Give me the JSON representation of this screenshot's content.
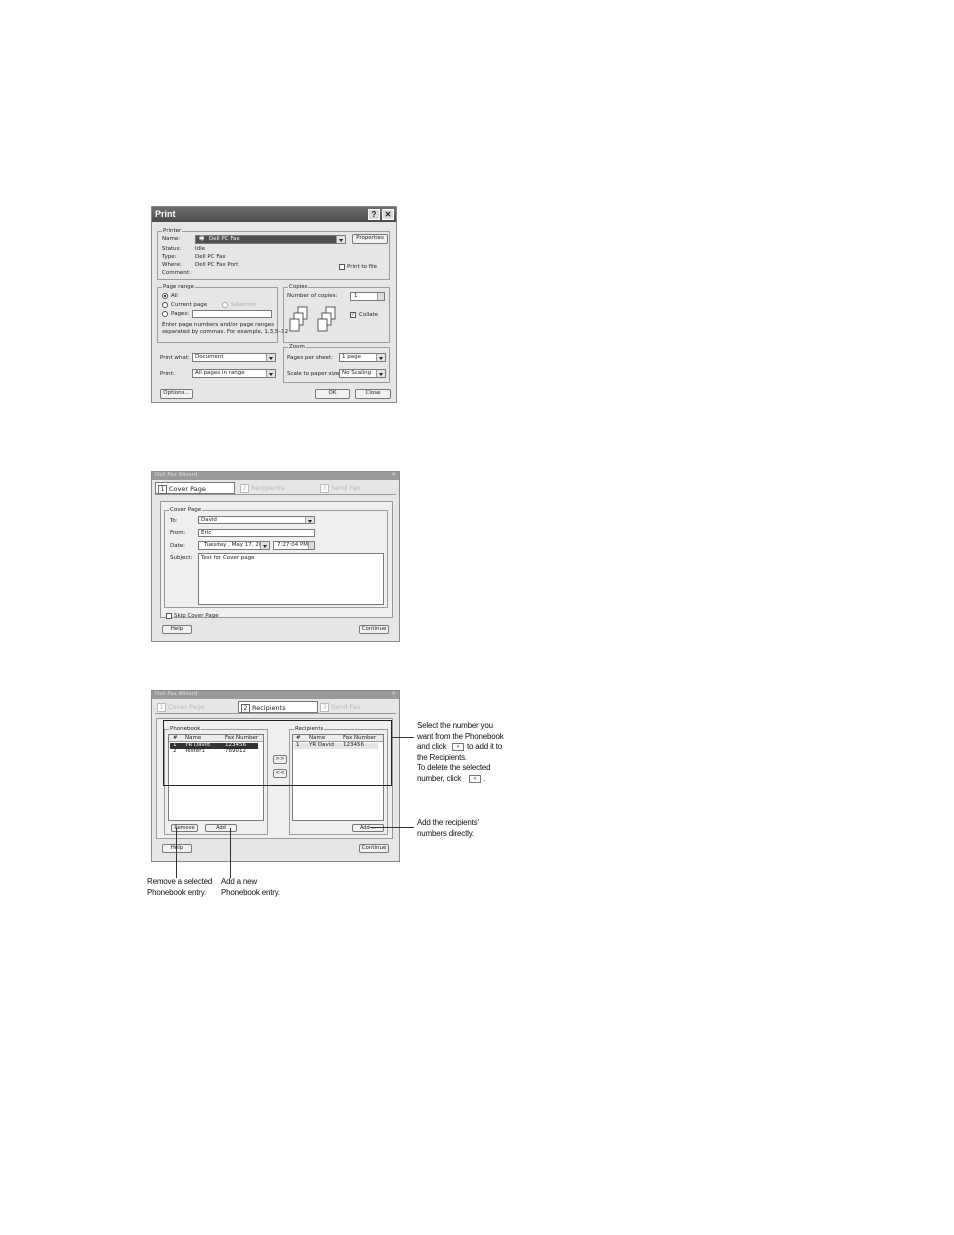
{
  "print_dialog": {
    "title": "Print",
    "help_btn": "?",
    "close_btn": "✕",
    "printer_group": "Printer",
    "name_label": "Name:",
    "name_value": "Dell PC Fax",
    "properties_btn": "Properties",
    "status_label": "Status:",
    "status_value": "Idle",
    "type_label": "Type:",
    "type_value": "Dell PC Fax",
    "where_label": "Where:",
    "where_value": "Dell PC Fax Port",
    "comment_label": "Comment:",
    "print_to_file": "Print to file",
    "page_range_group": "Page range",
    "all": "All",
    "current_page": "Current page",
    "selection": "Selection",
    "pages": "Pages:",
    "hint1": "Enter page numbers and/or page ranges",
    "hint2": "separated by commas.  For example, 1,3,5–12",
    "copies_group": "Copies",
    "num_copies": "Number of copies:",
    "copies_value": "1",
    "collate": "Collate",
    "print_what_label": "Print what:",
    "print_what_value": "Document",
    "print_label": "Print:",
    "print_value": "All pages in range",
    "zoom_group": "Zoom",
    "pps_label": "Pages per sheet:",
    "pps_value": "1 page",
    "scale_label": "Scale to paper size:",
    "scale_value": "No Scaling",
    "options_btn": "Options...",
    "ok_btn": "OK",
    "cancel_btn": "Close"
  },
  "cover_dialog": {
    "title": "Dell Fax Wizard",
    "tabs": [
      {
        "num": "1",
        "label": "Cover Page"
      },
      {
        "num": "2",
        "label": "Recipients"
      },
      {
        "num": "3",
        "label": "Send Fax"
      }
    ],
    "group": "Cover Page",
    "to_label": "To:",
    "to_value": "David",
    "from_label": "From:",
    "from_value": "Eric",
    "date_label": "Date:",
    "date_value": "Tuesday ,    May    17, 2005",
    "time_value": "7:27:04 PM",
    "subject_label": "Subject:",
    "subject_value": "Test for Cover page",
    "skip": "Skip Cover Page",
    "help_btn": "Help",
    "continue_btn": "Continue"
  },
  "recip_dialog": {
    "title": "Dell Fax Wizard",
    "tabs": [
      {
        "num": "1",
        "label": "Cover Page"
      },
      {
        "num": "2",
        "label": "Recipients"
      },
      {
        "num": "3",
        "label": "Send Fax"
      }
    ],
    "phonebook_group": "Phonebook",
    "recipients_group": "Recipients",
    "headers": [
      "#",
      "Name",
      "Fax Number"
    ],
    "phonebook_rows": [
      {
        "n": "1",
        "name": "YR David",
        "fax": "123456"
      },
      {
        "n": "2",
        "name": "Tester1",
        "fax": "789012"
      }
    ],
    "recipient_rows": [
      {
        "n": "1",
        "name": "YR David",
        "fax": "123456"
      }
    ],
    "move_right": ">>",
    "move_left": "<<",
    "remove_btn": "Remove",
    "add_btn": "Add",
    "add_recip_btn": "Add ...",
    "help_btn": "Help",
    "continue_btn": "Continue"
  },
  "annotations": {
    "select_1": "Select the number you",
    "select_2": "want from the Phonebook",
    "select_3a": "and click",
    "select_3b": "to add it to",
    "select_4": "the Recipients.",
    "select_5": "To delete the selected",
    "select_6": "number, click",
    "add_direct_1": "Add the recipients'",
    "add_direct_2": "numbers directly.",
    "remove_1": "Remove a selected",
    "remove_2": "Phonebook entry.",
    "addnew_1": "Add a new",
    "addnew_2": "Phonebook entry."
  }
}
